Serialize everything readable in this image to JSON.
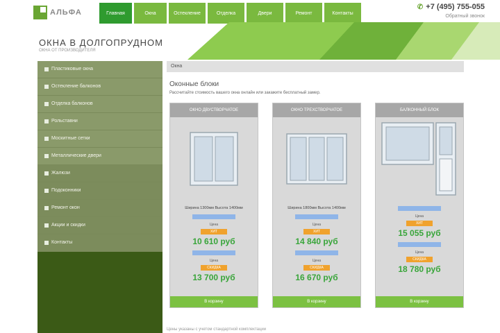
{
  "header": {
    "logo_text": "АЛЬФА",
    "phone": "+7 (495) 755-055",
    "callback": "Обратный звонок",
    "site_title": "ОКНА В ДОЛГОПРУДНОМ",
    "site_subtitle": "ОКНА ОТ ПРОИЗВОДИТЕЛЯ"
  },
  "nav": {
    "items": [
      {
        "label": "Главная"
      },
      {
        "label": "Окна"
      },
      {
        "label": "Остекление"
      },
      {
        "label": "Отделка"
      },
      {
        "label": "Двери"
      },
      {
        "label": "Ремонт"
      },
      {
        "label": "Контакты"
      }
    ]
  },
  "sidebar": {
    "items": [
      {
        "label": "Пластиковые окна"
      },
      {
        "label": "Остекление балконов"
      },
      {
        "label": "Отделка балконов"
      },
      {
        "label": "Рольставни"
      },
      {
        "label": "Москитные сетки"
      },
      {
        "label": "Металлические двери"
      },
      {
        "label": "Жалюзи"
      },
      {
        "label": "Подоконники"
      },
      {
        "label": "Ремонт окон"
      },
      {
        "label": "Акции и скидки"
      },
      {
        "label": "Контакты"
      }
    ]
  },
  "main": {
    "breadcrumb": "Окна",
    "title": "Оконные блоки",
    "description": "Рассчитайте стоимость вашего окна онлайн или закажите бесплатный замер."
  },
  "cards": [
    {
      "head": "ОКНО ДВУСТВОРЧАТОЕ",
      "size": "Ширина 1300мм Высота 1400мм",
      "badge1": "ХИТ",
      "price1": "10 610 руб",
      "badge2": "СКИДКА",
      "price2": "13 700 руб",
      "button": "В корзину"
    },
    {
      "head": "ОКНО ТРЕХСТВОРЧАТОЕ",
      "size": "Ширина 1800мм Высота 1400мм",
      "badge1": "ХИТ",
      "price1": "14 840 руб",
      "badge2": "СКИДКА",
      "price2": "16 670 руб",
      "button": "В корзину"
    },
    {
      "head": "БАЛКОННЫЙ БЛОК",
      "size": "",
      "badge1": "ХИТ",
      "price1": "15 055 руб",
      "badge2": "СКИДКА",
      "price2": "18 780 руб",
      "button": "В корзину"
    }
  ],
  "price_label": "Цена",
  "footer_note": "Цены указаны с учетом стандартной комплектации"
}
